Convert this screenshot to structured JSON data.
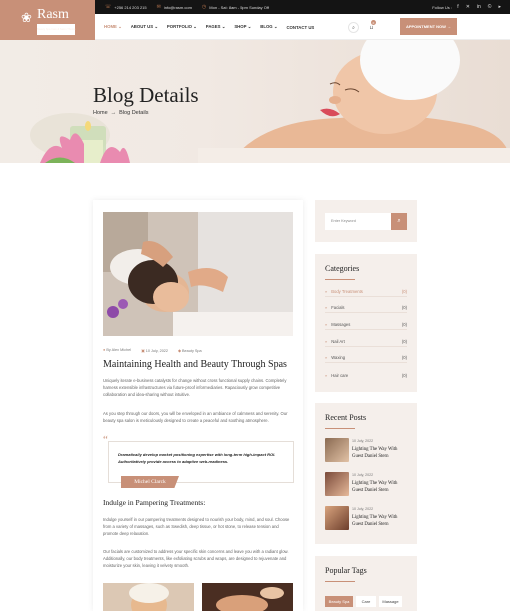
{
  "topbar": {
    "phone": "+256 214 203 215",
    "email": "info@rasm.com",
    "hours": "Mon - Sat: 8am - 5pm Sunday Off",
    "follow": "Follow Us :",
    "social": [
      "f",
      "✕",
      "in",
      "©",
      "▸"
    ]
  },
  "logo": {
    "name": "Rasm",
    "tagline": "Beauty Spa Care & Salon Theme"
  },
  "nav": {
    "items": [
      "HOME ⌄",
      "ABOUT US ⌄",
      "PORTFOLIO ⌄",
      "PAGES ⌄",
      "SHOP ⌄",
      "BLOG ⌄",
      "CONTACT US"
    ],
    "cart_count": "0",
    "appointment": "APPOINTMENT NOW →"
  },
  "hero": {
    "title": "Blog Details",
    "breadcrumb_home": "Home",
    "breadcrumb_sep": "→",
    "breadcrumb_current": "Blog Details"
  },
  "post": {
    "author": "By Alex Michel",
    "date": "10 July, 2022",
    "category": "Beauty Spa",
    "title": "Maintaining Health and Beauty Through Spas",
    "para1": "Uniquely iterate e-business catalysts for change without cross functional supply chains. Completely harness extensible infrastructures via future-proof informediaries. Rapaciously grow competitive collaboration and idea-sharing without intuitive.",
    "para2": "As you step through our doors, you will be enveloped in an ambiance of calmness and serenity. Our beauty spa salon is meticulously designed to create a peaceful and soothing atmosphere.",
    "quote": "Dramatically develop market positioning expertise with long-term high-impact ROI. Authoritatively provide access to adaptive web-readiness.",
    "quote_author": "Michel Clarck",
    "subheading": "Indulge in Pampering Treatments:",
    "para3": "Indulge yourself in our pampering treatments designed to nourish your body, mind, and soul. Choose from a variety of massages, such as Swedish, deep tissue, or hot stone, to release tension and promote deep relaxation.",
    "para4": "Our facials are customized to address your specific skin concerns and leave you with a radiant glow. Additionally, our body treatments, like exfoliating scrubs and wraps, are designed to rejuvenate and moisturize your skin, leaving it velvety smooth."
  },
  "sidebar": {
    "search_placeholder": "Enter Keyword",
    "categories_title": "Categories",
    "categories": [
      {
        "name": "Body Treatments",
        "count": "(0)"
      },
      {
        "name": "Facials",
        "count": "(0)"
      },
      {
        "name": "Massages",
        "count": "(0)"
      },
      {
        "name": "Nail Art",
        "count": "(0)"
      },
      {
        "name": "Waxing",
        "count": "(0)"
      },
      {
        "name": "Hair care",
        "count": "(0)"
      }
    ],
    "recent_title": "Recent Posts",
    "recent": [
      {
        "date": "10 July, 2022",
        "title": "Lighting The Way With Guest Daniel Stern"
      },
      {
        "date": "10 July, 2022",
        "title": "Lighting The Way With Guest Daniel Stern"
      },
      {
        "date": "10 July, 2022",
        "title": "Lighting The Way With Guest Daniel Stern"
      }
    ],
    "tags_title": "Popular Tags",
    "tags": [
      "Beauty Spa",
      "Care",
      "Massage"
    ]
  },
  "colors": {
    "accent": "#c89078",
    "dark": "#141414",
    "sidebar_bg": "#f5efeb"
  }
}
